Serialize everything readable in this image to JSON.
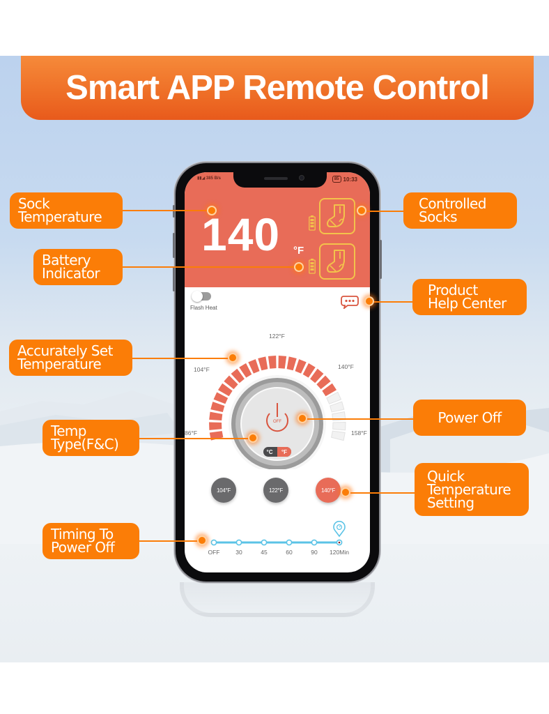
{
  "banner": {
    "title": "Smart APP Remote Control"
  },
  "phone": {
    "status_bar": {
      "signal_text": "385 B/s",
      "battery_level": "85",
      "time": "10:33"
    },
    "sock_temperature": {
      "value": "140",
      "unit": "°F"
    },
    "socks": [
      {
        "name": "left-sock",
        "battery_percent": 100
      },
      {
        "name": "right-sock",
        "battery_percent": 100
      }
    ],
    "flash_heat": {
      "label": "Flash Heat",
      "enabled": false
    },
    "gauge": {
      "min_label": "86°F",
      "label_104": "104°F",
      "label_122": "122°F",
      "label_140": "140°F",
      "max_label": "158°F",
      "min_value": 86,
      "max_value": 158,
      "current_value": 140,
      "segments_total": 24,
      "segments_filled": 19,
      "power_label": "OFF",
      "unit_celsius": "°C",
      "unit_fahrenheit": "°F",
      "selected_unit": "F"
    },
    "quick_temps": [
      {
        "label": "104°F",
        "selected": false
      },
      {
        "label": "122°F",
        "selected": false
      },
      {
        "label": "140°F",
        "selected": true
      }
    ],
    "timer": {
      "options": [
        "OFF",
        "30",
        "45",
        "60",
        "90",
        "120Min"
      ],
      "selected_index": 5
    }
  },
  "callouts": {
    "sock_temperature": [
      "Sock",
      "Temperature"
    ],
    "battery_indicator": [
      "Battery",
      "Indicator"
    ],
    "accurately_set": [
      "Accurately Set",
      "Temperature"
    ],
    "temp_type": [
      "Temp",
      "Type(F&C)"
    ],
    "timing_power_off": [
      "Timing To",
      "Power Off"
    ],
    "controlled_socks": [
      "Controlled",
      "Socks"
    ],
    "help_center": [
      "Product",
      "Help Center"
    ],
    "power_off": [
      "Power Off"
    ],
    "quick_setting": [
      "Quick",
      "Temperature",
      "Setting"
    ]
  },
  "colors": {
    "accent_orange": "#fb7d07",
    "app_red": "#e86c58",
    "sock_icon_yellow": "#f3c34b",
    "timer_blue": "#5bc3e6",
    "quick_gray": "#6a6a6c"
  }
}
